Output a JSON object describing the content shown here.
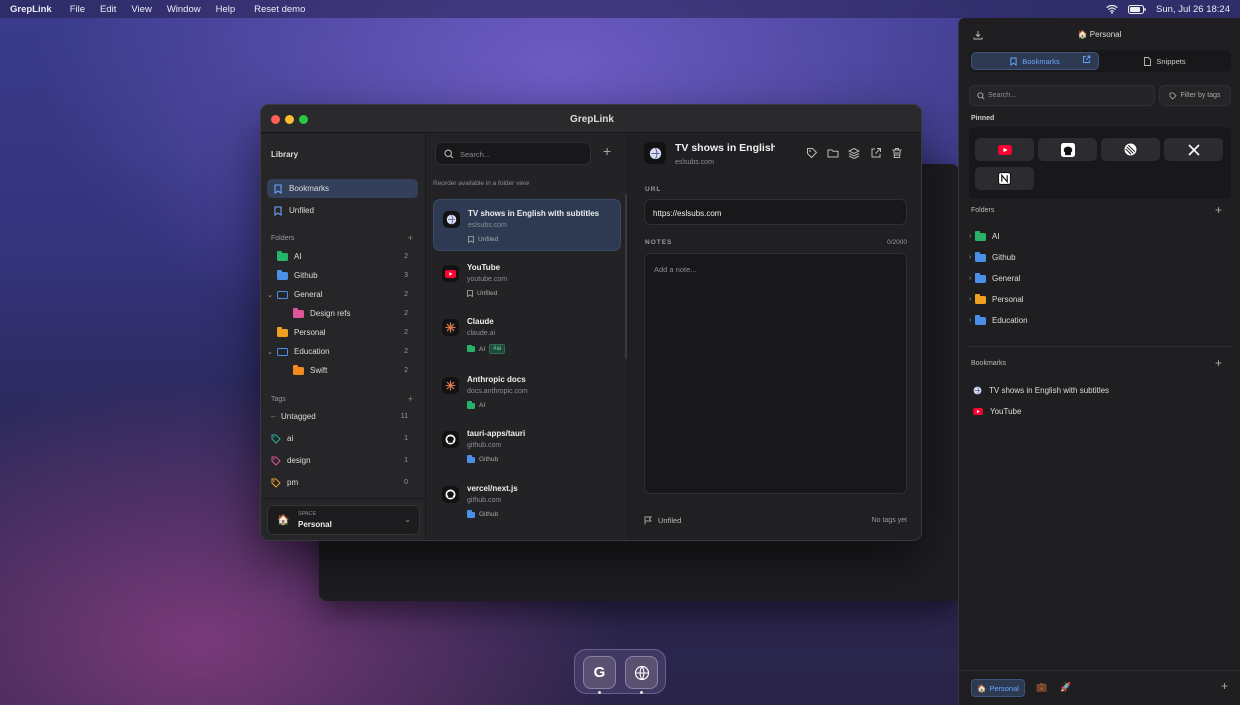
{
  "menubar": {
    "app": "GrepLink",
    "items": [
      "File",
      "Edit",
      "View",
      "Window",
      "Help",
      "Reset demo"
    ],
    "datetime": "Sun, Jul 26  18:24"
  },
  "window": {
    "title": "GrepLink"
  },
  "sidebar": {
    "library_label": "Library",
    "nav": [
      {
        "label": "Bookmarks"
      },
      {
        "label": "Unfiled"
      }
    ],
    "folders_label": "Folders",
    "folders": [
      {
        "label": "AI",
        "count": "2",
        "color": "#27b36a"
      },
      {
        "label": "Github",
        "count": "3",
        "color": "#4a8fe8"
      },
      {
        "label": "General",
        "count": "2",
        "color": "#4a8fe8"
      },
      {
        "label": "Design refs",
        "count": "2",
        "color": "#e0559a"
      },
      {
        "label": "Personal",
        "count": "2",
        "color": "#f0a020"
      },
      {
        "label": "Education",
        "count": "2",
        "color": "#4a8fe8"
      },
      {
        "label": "Swift",
        "count": "2",
        "color": "#f08a20"
      }
    ],
    "tags_label": "Tags",
    "tags": [
      {
        "label": "Untagged",
        "count": "11"
      },
      {
        "label": "ai",
        "count": "1",
        "color": "#27b39a"
      },
      {
        "label": "design",
        "count": "1",
        "color": "#e0559a"
      },
      {
        "label": "pm",
        "count": "0",
        "color": "#f0a020"
      }
    ],
    "space": {
      "label": "SPACE",
      "value": "Personal"
    }
  },
  "list": {
    "search_placeholder": "Search...",
    "hint": "Reorder available in a folder view",
    "items": [
      {
        "title": "TV shows in English with subtitles",
        "domain": "eslsubs.com",
        "meta": "Unfiled"
      },
      {
        "title": "YouTube",
        "domain": "youtube.com",
        "meta": "Unfiled"
      },
      {
        "title": "Claude",
        "domain": "claude.ai",
        "meta": "AI",
        "tag": "#ai"
      },
      {
        "title": "Anthropic docs",
        "domain": "docs.anthropic.com",
        "meta": "AI"
      },
      {
        "title": "tauri-apps/tauri",
        "domain": "github.com",
        "meta": "Github"
      },
      {
        "title": "vercel/next.js",
        "domain": "github.com",
        "meta": "Github"
      }
    ]
  },
  "detail": {
    "title": "TV shows in English",
    "domain": "eslsubs.com",
    "url_label": "URL",
    "url": "https://eslsubs.com",
    "notes_label": "NOTES",
    "notes_count": "0/2000",
    "notes_placeholder": "Add a note...",
    "folder_status": "Unfiled",
    "tags_status": "No tags yet"
  },
  "panel": {
    "space": "Personal",
    "tabs": [
      "Bookmarks",
      "Snippets"
    ],
    "search_placeholder": "Search...",
    "filter_label": "Filter by tags",
    "pinned_label": "Pinned",
    "folders_label": "Folders",
    "folders": [
      {
        "label": "AI",
        "color": "#27b36a"
      },
      {
        "label": "Github",
        "color": "#4a8fe8"
      },
      {
        "label": "General",
        "color": "#4a8fe8"
      },
      {
        "label": "Personal",
        "color": "#f0a020"
      },
      {
        "label": "Education",
        "color": "#4a8fe8"
      }
    ],
    "bookmarks_label": "Bookmarks",
    "bookmarks": [
      {
        "label": "TV shows in English with subtitles"
      },
      {
        "label": "YouTube"
      }
    ],
    "footer_space": "Personal"
  },
  "dock": {
    "app_letter": "G"
  }
}
